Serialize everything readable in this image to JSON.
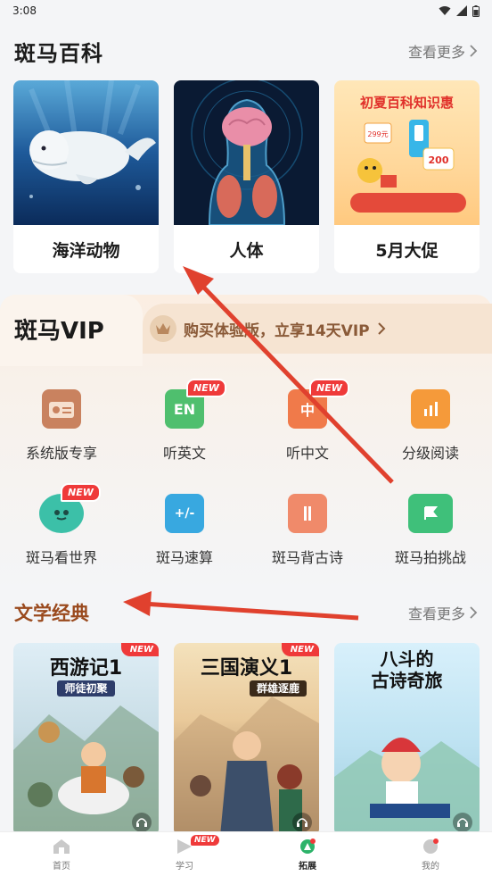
{
  "status": {
    "time": "3:08"
  },
  "encyclopedia": {
    "title": "斑马百科",
    "more": "查看更多",
    "cards": [
      {
        "label": "海洋动物"
      },
      {
        "label": "人体"
      },
      {
        "label": "5月大促",
        "promo_title": "初夏百科知识惠",
        "promo_tag": "299元",
        "promo_tag2": "200"
      }
    ]
  },
  "vip": {
    "title": "斑马VIP",
    "banner": "购买体验版，立享14天VIP",
    "row1": [
      {
        "label": "系统版专享",
        "icon": "radio-icon",
        "color": "#c9825f",
        "new": ""
      },
      {
        "label": "听英文",
        "icon": "en-icon",
        "color": "#4fbf6e",
        "new": "NEW",
        "glyph": "EN"
      },
      {
        "label": "听中文",
        "icon": "zhong-icon",
        "color": "#f07a4a",
        "new": "NEW",
        "glyph": "中"
      },
      {
        "label": "分级阅读",
        "icon": "reading-icon",
        "color": "#f59a3a",
        "new": ""
      }
    ],
    "row2": [
      {
        "label": "斑马看世界",
        "icon": "globe-icon",
        "color": "#3cc0a8",
        "new": "NEW"
      },
      {
        "label": "斑马速算",
        "icon": "calc-icon",
        "color": "#38a8e0",
        "new": "",
        "glyph": "+/-"
      },
      {
        "label": "斑马背古诗",
        "icon": "scroll-icon",
        "color": "#f08a6a",
        "new": ""
      },
      {
        "label": "斑马拍挑战",
        "icon": "camera-icon",
        "color": "#3fc07a",
        "new": ""
      }
    ]
  },
  "literature": {
    "title": "文学经典",
    "more": "查看更多",
    "books": [
      {
        "title": "西游记1",
        "subtitle": "师徒初聚",
        "new": "NEW"
      },
      {
        "title": "三国演义1",
        "subtitle": "群雄逐鹿",
        "new": "NEW"
      },
      {
        "title": "八斗的\n古诗奇旅",
        "subtitle": "",
        "new": ""
      }
    ]
  },
  "nav": [
    {
      "label": "首页",
      "icon": "home-icon"
    },
    {
      "label": "学习",
      "icon": "study-icon",
      "new": "NEW"
    },
    {
      "label": "拓展",
      "icon": "explore-icon",
      "active": true
    },
    {
      "label": "我的",
      "icon": "profile-icon"
    }
  ]
}
